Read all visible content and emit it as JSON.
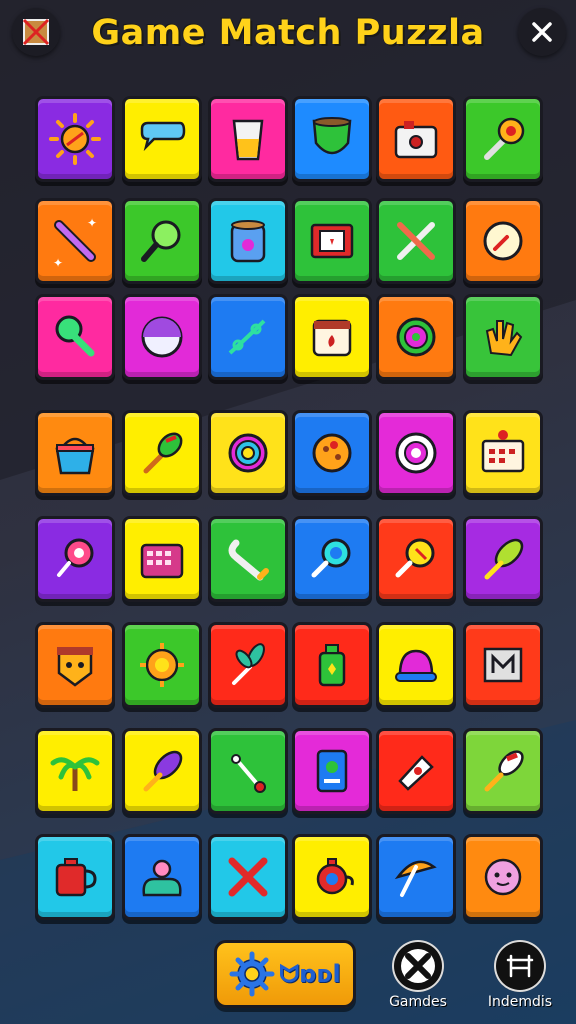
{
  "header": {
    "title": "Game Match Puzzla",
    "left_icon": "crossed-box-icon",
    "close_icon": "close-icon"
  },
  "board": {
    "rows": 8,
    "cols": 6,
    "tiles": [
      {
        "color": "#8a2be2",
        "icon": "sun-icon"
      },
      {
        "color": "#ffee00",
        "icon": "speech-bubble-icon"
      },
      {
        "color": "#ff2aa0",
        "icon": "glass-icon"
      },
      {
        "color": "#1e8bff",
        "icon": "shield-cup-icon"
      },
      {
        "color": "#ff5a12",
        "icon": "radio-icon"
      },
      {
        "color": "#3cc82a",
        "icon": "torch-icon"
      },
      {
        "color": "#ff7a10",
        "icon": "pencil-icon"
      },
      {
        "color": "#3cc82a",
        "icon": "magnifier-icon"
      },
      {
        "color": "#22c8e8",
        "icon": "jar-icon"
      },
      {
        "color": "#2ec23a",
        "icon": "box-icon"
      },
      {
        "color": "#2ec23a",
        "icon": "crossed-tools-icon"
      },
      {
        "color": "#ff7a10",
        "icon": "compass-icon"
      },
      {
        "color": "#ff2aa0",
        "icon": "wrench-ball-icon"
      },
      {
        "color": "#e22ad8",
        "icon": "half-ball-icon"
      },
      {
        "color": "#1e7bf2",
        "icon": "branch-icon"
      },
      {
        "color": "#ffee00",
        "icon": "toaster-icon"
      },
      {
        "color": "#ff7a10",
        "icon": "target-icon"
      },
      {
        "color": "#38c43a",
        "icon": "hand-icon"
      },
      {
        "color": "#ff8a10",
        "icon": "basket-icon"
      },
      {
        "color": "#ffee00",
        "icon": "brush-icon"
      },
      {
        "color": "#ffe21a",
        "icon": "ring-icon"
      },
      {
        "color": "#1e7bf2",
        "icon": "cookie-icon"
      },
      {
        "color": "#e42ad8",
        "icon": "donut-icon"
      },
      {
        "color": "#ffe21a",
        "icon": "calendar-icon"
      },
      {
        "color": "#8a2be2",
        "icon": "lollipop-icon"
      },
      {
        "color": "#ffee00",
        "icon": "keypad-icon"
      },
      {
        "color": "#2ec23a",
        "icon": "wrench-icon"
      },
      {
        "color": "#1e7bf2",
        "icon": "lens-icon"
      },
      {
        "color": "#ff3a1a",
        "icon": "spoon-icon"
      },
      {
        "color": "#a62be2",
        "icon": "leaf-brush-icon"
      },
      {
        "color": "#ff7a10",
        "icon": "mask-icon"
      },
      {
        "color": "#3cc82a",
        "icon": "gear-sun-icon"
      },
      {
        "color": "#ff2a1a",
        "icon": "plant-icon"
      },
      {
        "color": "#ff2a1a",
        "icon": "bottle-icon"
      },
      {
        "color": "#ffee00",
        "icon": "bell-icon"
      },
      {
        "color": "#ff3a1a",
        "icon": "frame-icon"
      },
      {
        "color": "#ffee00",
        "icon": "palm-icon"
      },
      {
        "color": "#ffee00",
        "icon": "feather-icon"
      },
      {
        "color": "#2ec23a",
        "icon": "tool-icon"
      },
      {
        "color": "#e42ad8",
        "icon": "phone-icon"
      },
      {
        "color": "#ff2a1a",
        "icon": "pen-nib-icon"
      },
      {
        "color": "#7ed63a",
        "icon": "paint-brush-icon"
      },
      {
        "color": "#22c8e8",
        "icon": "mug-icon"
      },
      {
        "color": "#1e7bf2",
        "icon": "octopus-icon"
      },
      {
        "color": "#22c8e8",
        "icon": "cross-sticks-icon"
      },
      {
        "color": "#ffee00",
        "icon": "teapot-icon"
      },
      {
        "color": "#1e7bf2",
        "icon": "umbrella-icon"
      },
      {
        "color": "#ff8a10",
        "icon": "flower-face-icon"
      }
    ]
  },
  "footer": {
    "play": {
      "label": "ᗢɒᴅl",
      "icon": "gear-icon"
    },
    "nav_left": {
      "label": "Gamdes",
      "icon": "cross-icon"
    },
    "nav_right": {
      "label": "Indemdis",
      "icon": "chair-icon"
    }
  }
}
